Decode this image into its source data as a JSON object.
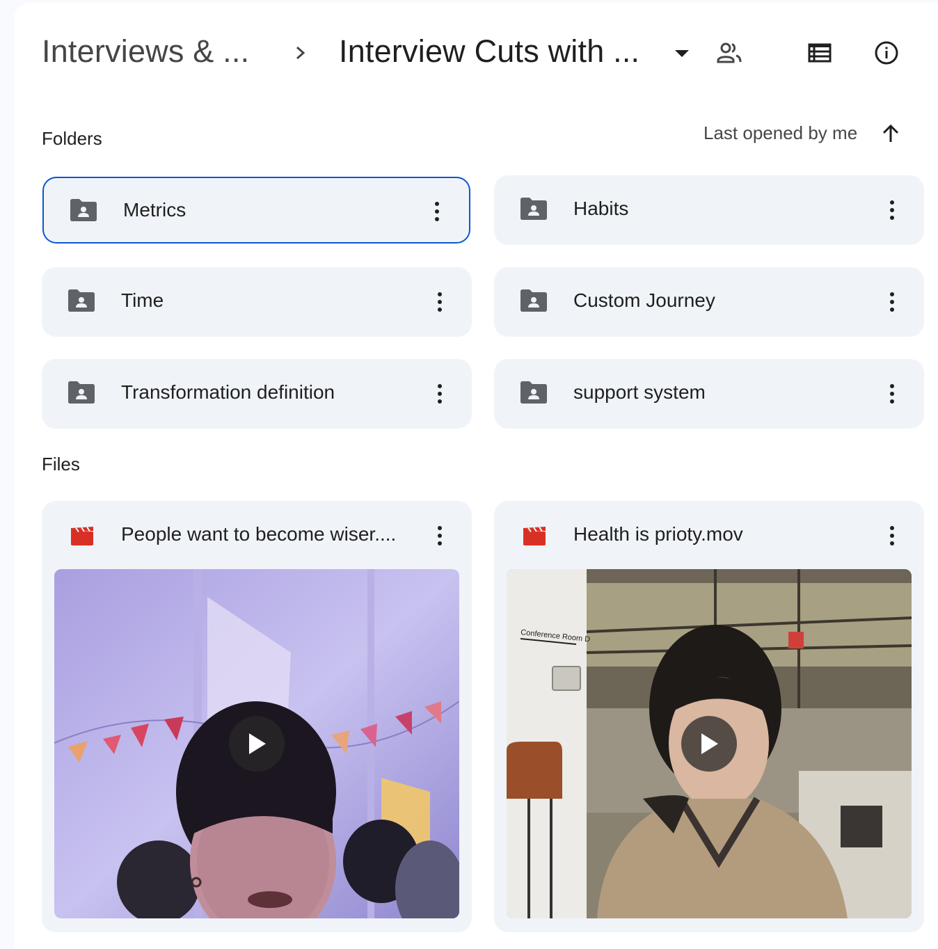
{
  "breadcrumb": {
    "parent": "Interviews & ...",
    "current": "Interview Cuts with ..."
  },
  "header_icons": [
    "shared-people-icon",
    "list-view-icon",
    "info-icon"
  ],
  "sections": {
    "folders_title": "Folders",
    "files_title": "Files"
  },
  "sort": {
    "label": "Last opened by me",
    "direction_icon": "arrow-up-icon"
  },
  "folders": [
    {
      "name": "Metrics",
      "selected": true
    },
    {
      "name": "Habits"
    },
    {
      "name": "Time"
    },
    {
      "name": "Custom Journey"
    },
    {
      "name": "Transformation definition"
    },
    {
      "name": "support system"
    }
  ],
  "files": [
    {
      "name": "People want to become wiser....",
      "icon": "video-file-icon"
    },
    {
      "name": "Health is prioty.mov",
      "icon": "video-file-icon"
    }
  ],
  "colors": {
    "accent": "#0b57d0",
    "card_bg": "#f0f4f9",
    "video_icon": "#d93025",
    "folder_icon": "#5f6368"
  }
}
